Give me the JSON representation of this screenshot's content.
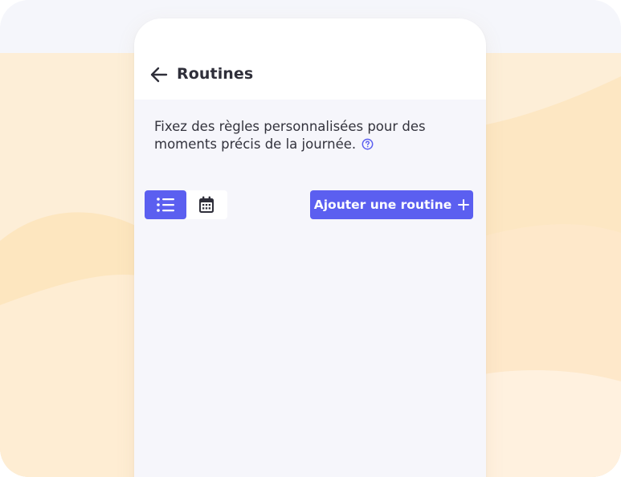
{
  "header": {
    "back_icon": "arrow-left-icon",
    "title": "Routines"
  },
  "description": {
    "text": "Fixez des règles personnalisées pour des moments précis de la journée.",
    "help_icon": "question-circle-icon"
  },
  "toolbar": {
    "view_modes": [
      {
        "icon": "list-icon",
        "selected": true
      },
      {
        "icon": "calendar-icon",
        "selected": false
      }
    ],
    "add_button": {
      "label": "Ajouter une routine",
      "icon": "plus-icon"
    }
  },
  "colors": {
    "accent": "#5b5ff0",
    "background": "#f6f6fb",
    "decor_peach": "#fde9c8",
    "text": "#2f2f3a"
  }
}
